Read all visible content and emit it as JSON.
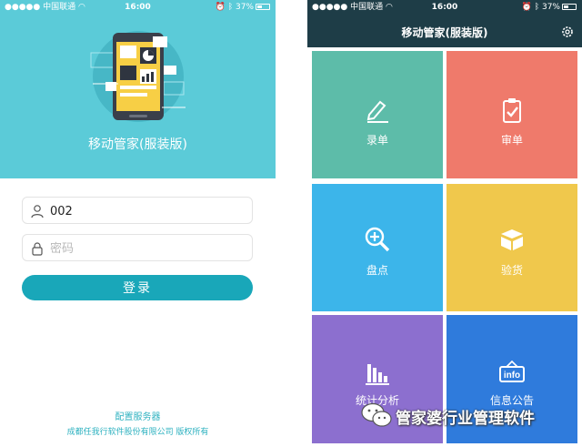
{
  "login_screen": {
    "status_bar": {
      "carrier": "中国联通",
      "time": "16:00",
      "battery": "37%"
    },
    "app_title": "移动管家(服装版)",
    "username": {
      "value": "002",
      "placeholder": ""
    },
    "password": {
      "value": "",
      "placeholder": "密码"
    },
    "login_label": "登录",
    "config_server_label": "配置服务器",
    "copyright": "成都任我行软件股份有限公司 版权所有"
  },
  "home_screen": {
    "status_bar": {
      "carrier": "中国联通",
      "time": "16:00",
      "battery": "37%"
    },
    "app_title": "移动管家(服装版)",
    "tiles": [
      {
        "label": "录单",
        "icon": "pencil-icon"
      },
      {
        "label": "审单",
        "icon": "clipboard-check-icon"
      },
      {
        "label": "盘点",
        "icon": "zoom-in-icon"
      },
      {
        "label": "验货",
        "icon": "box-icon"
      },
      {
        "label": "统计分析",
        "icon": "bar-chart-icon"
      },
      {
        "label": "信息公告",
        "icon": "info-sign-icon"
      }
    ]
  },
  "watermark": {
    "text": "管家婆行业管理软件",
    "icon": "wechat-icon"
  },
  "colors": {
    "login_hero": "#5bcbd8",
    "login_button": "#19a7b9",
    "header": "#1e3d47",
    "tile_record": "#5dbca9",
    "tile_audit": "#ef7a6b",
    "tile_inventory": "#3cb5ea",
    "tile_inspect": "#f0c84c",
    "tile_stats": "#8c6fcf",
    "tile_notice": "#2f7bdc"
  }
}
